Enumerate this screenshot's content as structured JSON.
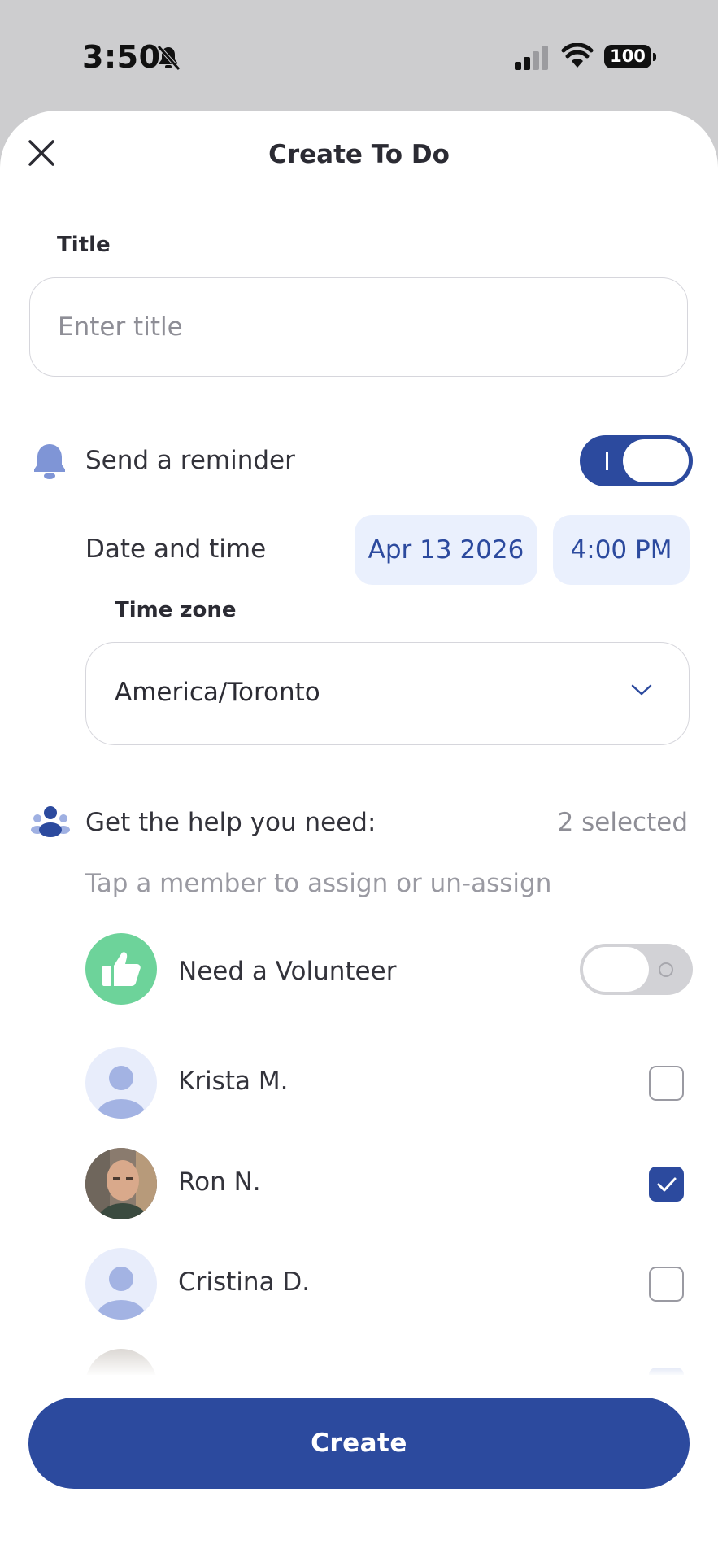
{
  "status_bar": {
    "time": "3:50",
    "battery": "100"
  },
  "header": {
    "title": "Create To Do"
  },
  "title_field": {
    "label": "Title",
    "placeholder": "Enter title",
    "value": ""
  },
  "reminder": {
    "label": "Send a reminder",
    "enabled": true,
    "date_time_label": "Date and time",
    "date": "Apr 13 2026",
    "time": "4:00 PM",
    "timezone_label": "Time zone",
    "timezone": "America/Toronto"
  },
  "help": {
    "label": "Get the help you need:",
    "selected_count": "2 selected",
    "hint": "Tap a member to assign or un-assign",
    "volunteer": {
      "label": "Need a Volunteer",
      "enabled": false
    },
    "members": [
      {
        "name": "Krista M.",
        "checked": false,
        "avatar": "placeholder"
      },
      {
        "name": "Ron N.",
        "checked": true,
        "avatar": "photo"
      },
      {
        "name": "Cristina D.",
        "checked": false,
        "avatar": "placeholder"
      }
    ]
  },
  "footer": {
    "create_label": "Create"
  },
  "colors": {
    "accent": "#2c4a9e",
    "chip_bg": "#eaf0fd",
    "volunteer_green": "#6dd39a",
    "icon_blue": "#7f95d6"
  },
  "icons": {
    "close": "close-icon",
    "bell": "bell-icon",
    "people": "people-icon",
    "thumbs_up": "thumbs-up-icon",
    "chevron": "chevron-down-icon"
  }
}
